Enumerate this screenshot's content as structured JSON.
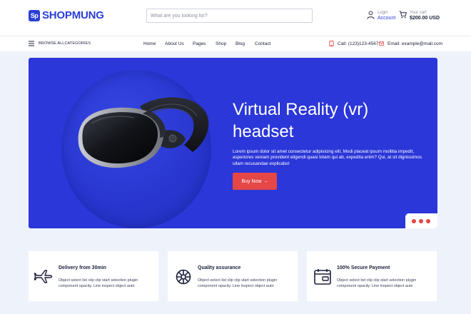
{
  "brand": {
    "mark": "Sp",
    "name": "SHOPMUNG"
  },
  "search": {
    "placeholder": "What are you looking for?"
  },
  "account": {
    "label": "Login",
    "value": "Account"
  },
  "cart": {
    "label": "Your cart",
    "total": "$200.00 USD"
  },
  "categories": {
    "label": "BROWSE ALLCATEGORIES"
  },
  "nav": {
    "items": [
      "Home",
      "About Us",
      "Pages",
      "Shop",
      "Blog",
      "Contact"
    ]
  },
  "contact": {
    "phone": "Call: (123)123-4567",
    "email": "Email: example@mail.com"
  },
  "hero": {
    "title": "Virtual Reality (vr) headset",
    "description": "Lorem ipsum dolor sit amet consectetur adipisicing elit. Modi placeat ipsum mollitia impedit, asperiores veniam provident eligendi quasi totam qui ab, expedita enim? Qui, at sit dignissimos ullam recusandae explicabo!",
    "button": "Buy Now →"
  },
  "features": [
    {
      "title": "Delivery from 30min",
      "description": "Object select list clip clip start selection plugin component opacity. Line inspect object auto",
      "icon": "airplane-icon"
    },
    {
      "title": "Quality assurance",
      "description": "Object select list clip clip start selection plugin component opacity. Line inspect object auto",
      "icon": "ship-wheel-icon"
    },
    {
      "title": "100% Secure Payment",
      "description": "Object select list clip clip start selection plugin component opacity. Line inspect object auto",
      "icon": "wallet-icon"
    }
  ],
  "colors": {
    "brand": "#2b3fd6",
    "hero": "#2b37d8",
    "accent": "#e54646",
    "background": "#eef3fb"
  },
  "slider": {
    "dots": [
      "#e54646",
      "#e54646",
      "#e54646"
    ]
  }
}
